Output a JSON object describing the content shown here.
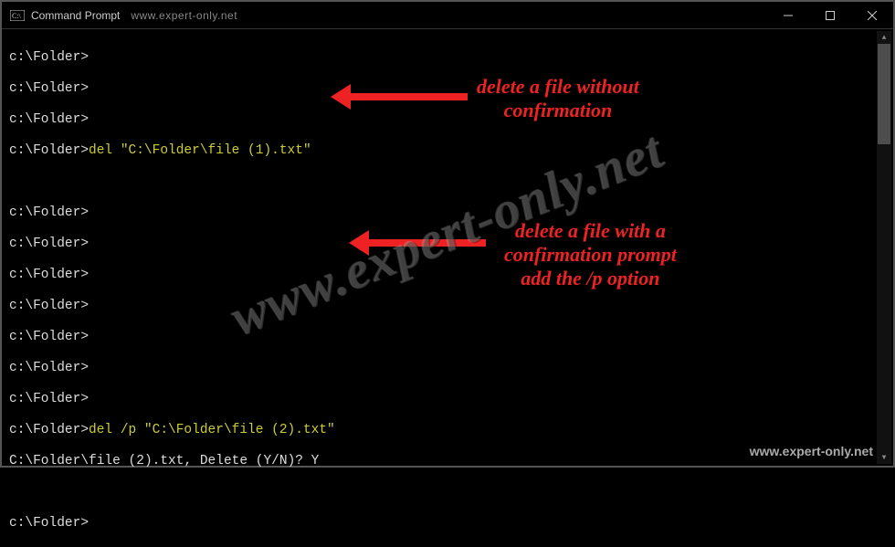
{
  "titlebar": {
    "title": "Command Prompt",
    "subtitle": "www.expert-only.net"
  },
  "prompt": "c:\\Folder>",
  "prompt_upper": "C:\\Folder",
  "cmd1": "del \"C:\\Folder\\file (1).txt\"",
  "cmd2": "del /p \"C:\\Folder\\file (2).txt\"",
  "confirm_line": "\\file (2).txt, Delete (Y/N)? Y",
  "annot1": "delete a file without\nconfirmation",
  "annot2": "delete a file with a\nconfirmation prompt\nadd the /p option",
  "watermark": "www.expert-only.net",
  "footer": "www.expert-only.net"
}
